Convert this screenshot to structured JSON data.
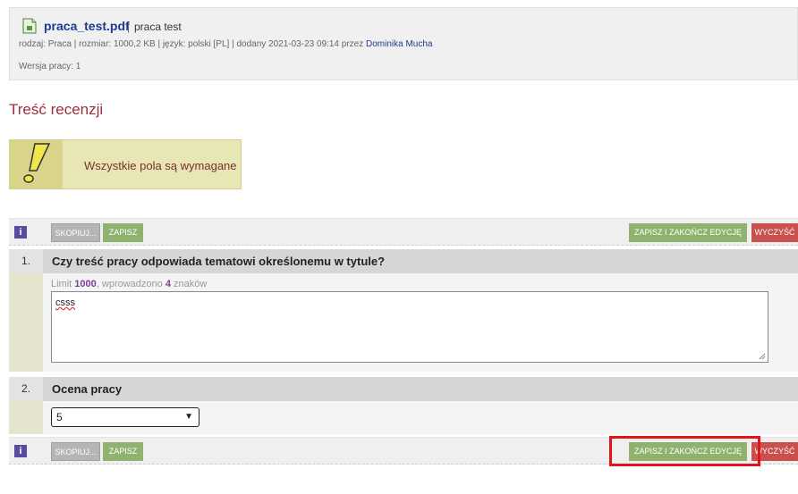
{
  "file": {
    "name": "praca_test.pdf",
    "separator": "|",
    "title": "praca test",
    "meta_prefix": "rodzaj: Praca | rozmiar: 1000,2 KB | język: polski [PL] | dodany 2021-03-23 09:14 przez ",
    "author": "Dominika Mucha",
    "version": "Wersja pracy: 1",
    "icon": "pdf-file-icon"
  },
  "section": {
    "title": "Treść recenzji"
  },
  "warning": {
    "text": "Wszystkie pola są wymagane",
    "icon": "exclamation-icon"
  },
  "toolbar": {
    "info_label": "i",
    "copy_label": "SKOPIUJ...",
    "save_label": "ZAPISZ",
    "finish_label": "ZAPISZ I ZAKOŃCZ EDYCJĘ",
    "clear_label": "WYCZYŚĆ"
  },
  "questions": [
    {
      "number": "1.",
      "text": "Czy treść pracy odpowiada tematowi określonemu w tytule?",
      "limit_prefix": "Limit ",
      "limit_value": "1000",
      "limit_middle": ", wprowadzono ",
      "entered_value": "4",
      "limit_suffix": " znaków",
      "answer": "csss"
    },
    {
      "number": "2.",
      "text": "Ocena pracy",
      "selected": "5"
    }
  ],
  "colors": {
    "link": "#1f3a93",
    "section_title": "#9b2f3e",
    "save_green": "#8fb36e",
    "clear_red": "#c9504d",
    "highlight": "#e0151b"
  }
}
